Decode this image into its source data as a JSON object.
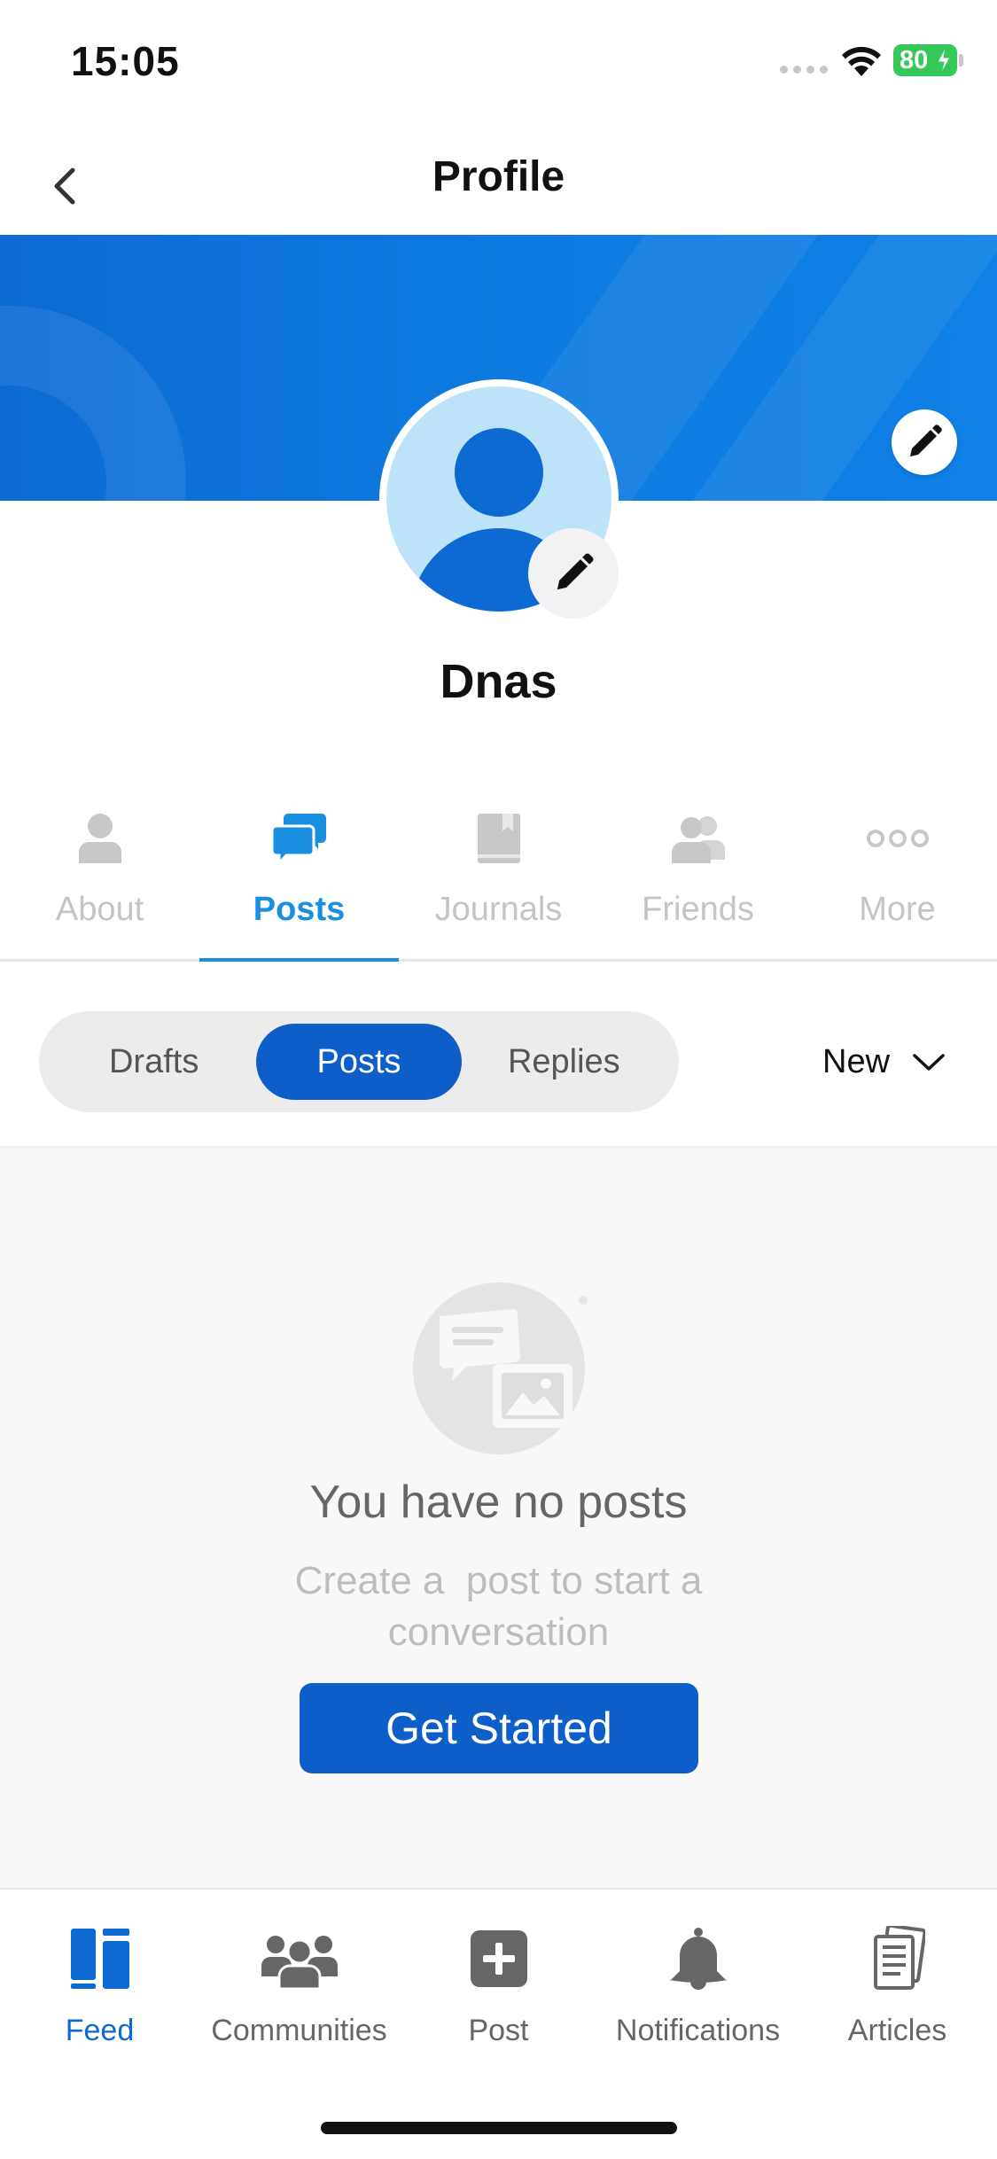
{
  "status_bar": {
    "time": "15:05",
    "battery": "80"
  },
  "header": {
    "title": "Profile"
  },
  "profile": {
    "name": "Dnas"
  },
  "profile_tabs": [
    {
      "label": "About",
      "icon": "person-icon",
      "active": false
    },
    {
      "label": "Posts",
      "icon": "chat-bubbles-icon",
      "active": true
    },
    {
      "label": "Journals",
      "icon": "book-icon",
      "active": false
    },
    {
      "label": "Friends",
      "icon": "friends-icon",
      "active": false
    },
    {
      "label": "More",
      "icon": "more-dots-icon",
      "active": false
    }
  ],
  "segments": [
    {
      "label": "Drafts",
      "active": false
    },
    {
      "label": "Posts",
      "active": true
    },
    {
      "label": "Replies",
      "active": false
    }
  ],
  "sort": {
    "label": "New"
  },
  "empty_state": {
    "title": "You have no posts",
    "subtitle": "Create a  post to start a conversation",
    "button": "Get Started"
  },
  "bottom_tabs": [
    {
      "label": "Feed",
      "icon": "feed-icon",
      "active": true
    },
    {
      "label": "Communities",
      "icon": "communities-icon",
      "active": false
    },
    {
      "label": "Post",
      "icon": "add-post-icon",
      "active": false
    },
    {
      "label": "Notifications",
      "icon": "bell-icon",
      "active": false
    },
    {
      "label": "Articles",
      "icon": "articles-icon",
      "active": false
    }
  ],
  "colors": {
    "accent": "#0d5ec8",
    "active_tab": "#1a8fe0",
    "banner": "#0d79de",
    "avatar_bg": "#bde3f8"
  }
}
